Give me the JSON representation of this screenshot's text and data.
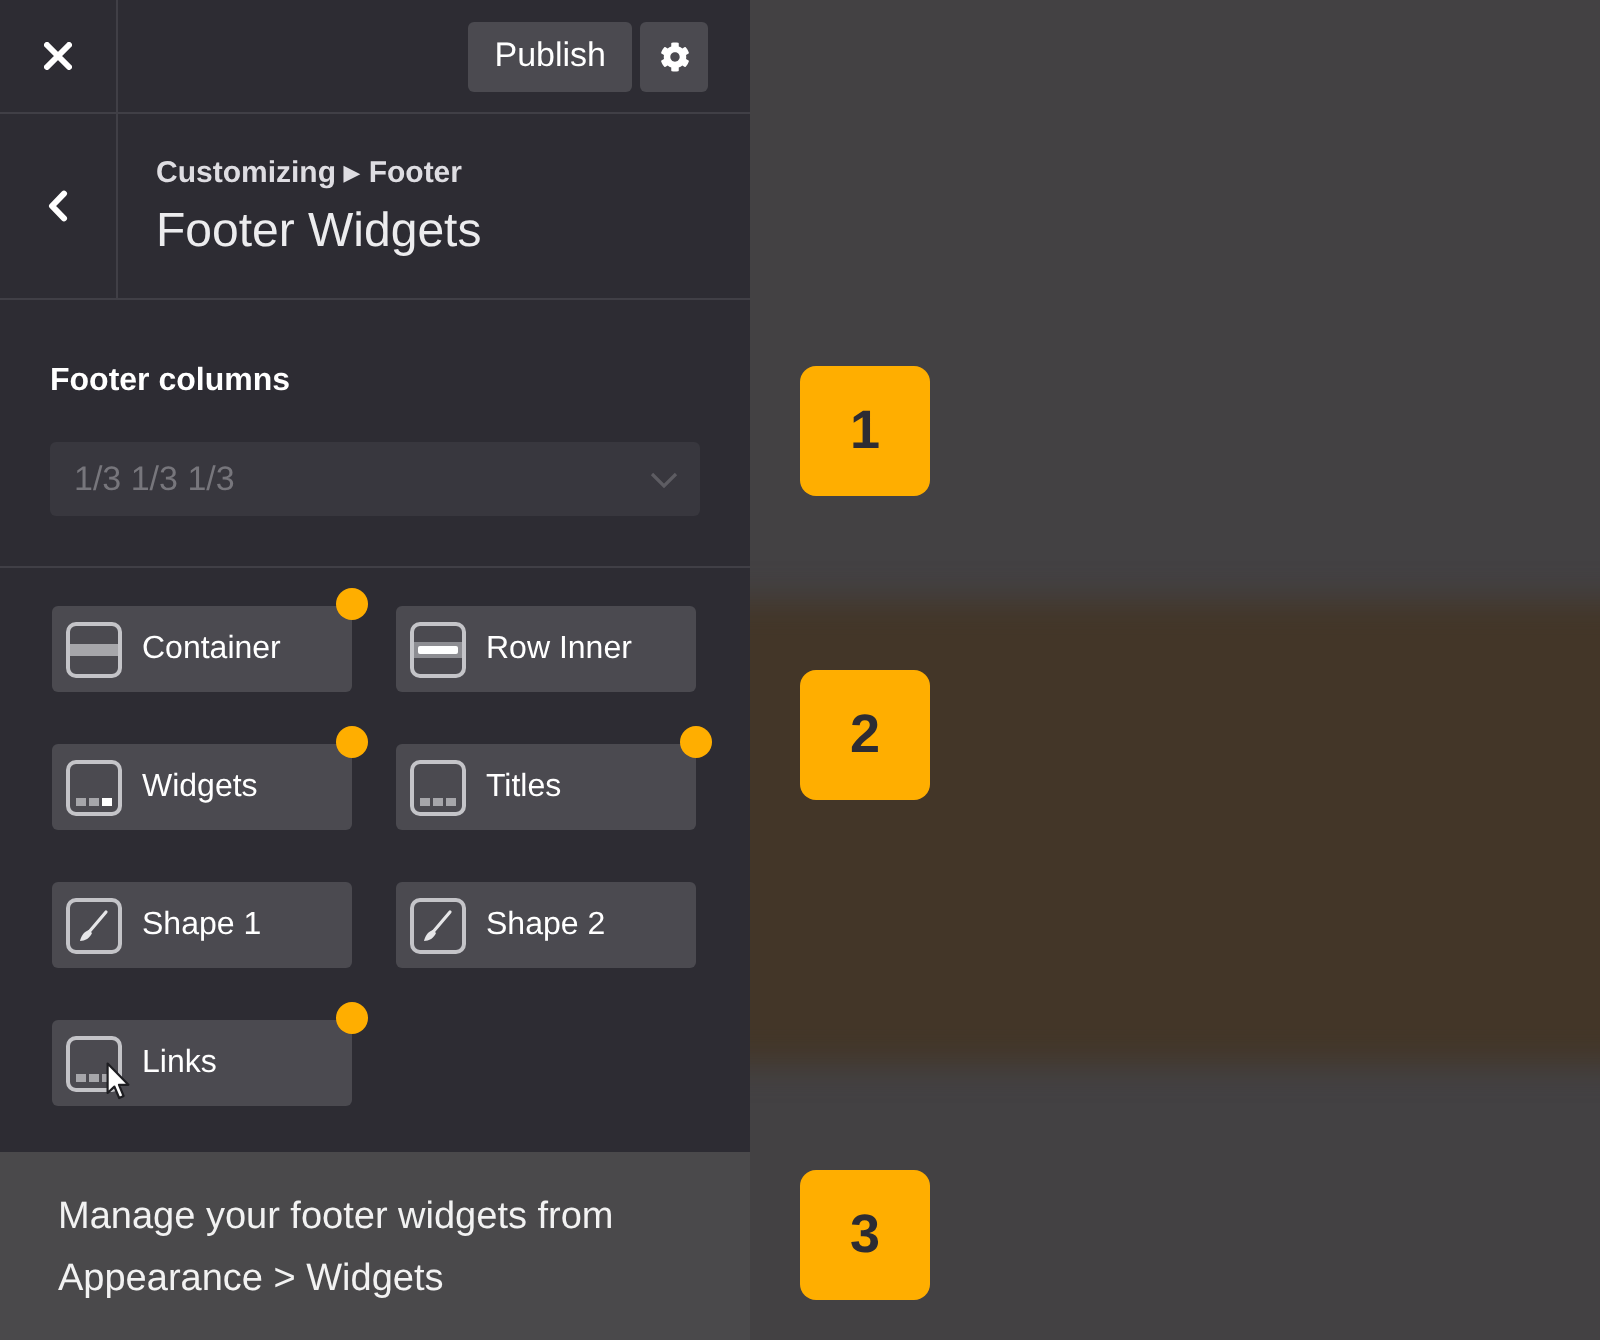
{
  "top_bar": {
    "publish_button": "Publish"
  },
  "header": {
    "breadcrumb": "Customizing ▸ Footer",
    "title": "Footer Widgets"
  },
  "footer_columns": {
    "label": "Footer columns",
    "value": "1/3 1/3 1/3",
    "disabled": true
  },
  "elements": [
    {
      "label": "Container",
      "kind": "band",
      "modified": true,
      "pointer": false
    },
    {
      "label": "Row Inner",
      "kind": "bar",
      "modified": false,
      "pointer": false
    },
    {
      "label": "Widgets",
      "kind": "tiles",
      "modified": true,
      "pointer": false
    },
    {
      "label": "Titles",
      "kind": "dots",
      "modified": true,
      "pointer": false
    },
    {
      "label": "Shape 1",
      "kind": "brush",
      "modified": false,
      "pointer": false
    },
    {
      "label": "Shape 2",
      "kind": "brush",
      "modified": false,
      "pointer": false
    },
    {
      "label": "Links",
      "kind": "dots",
      "modified": true,
      "pointer": true
    }
  ],
  "note": "Manage your footer widgets from Appearance > Widgets",
  "callouts": [
    "1",
    "2",
    "3"
  ]
}
